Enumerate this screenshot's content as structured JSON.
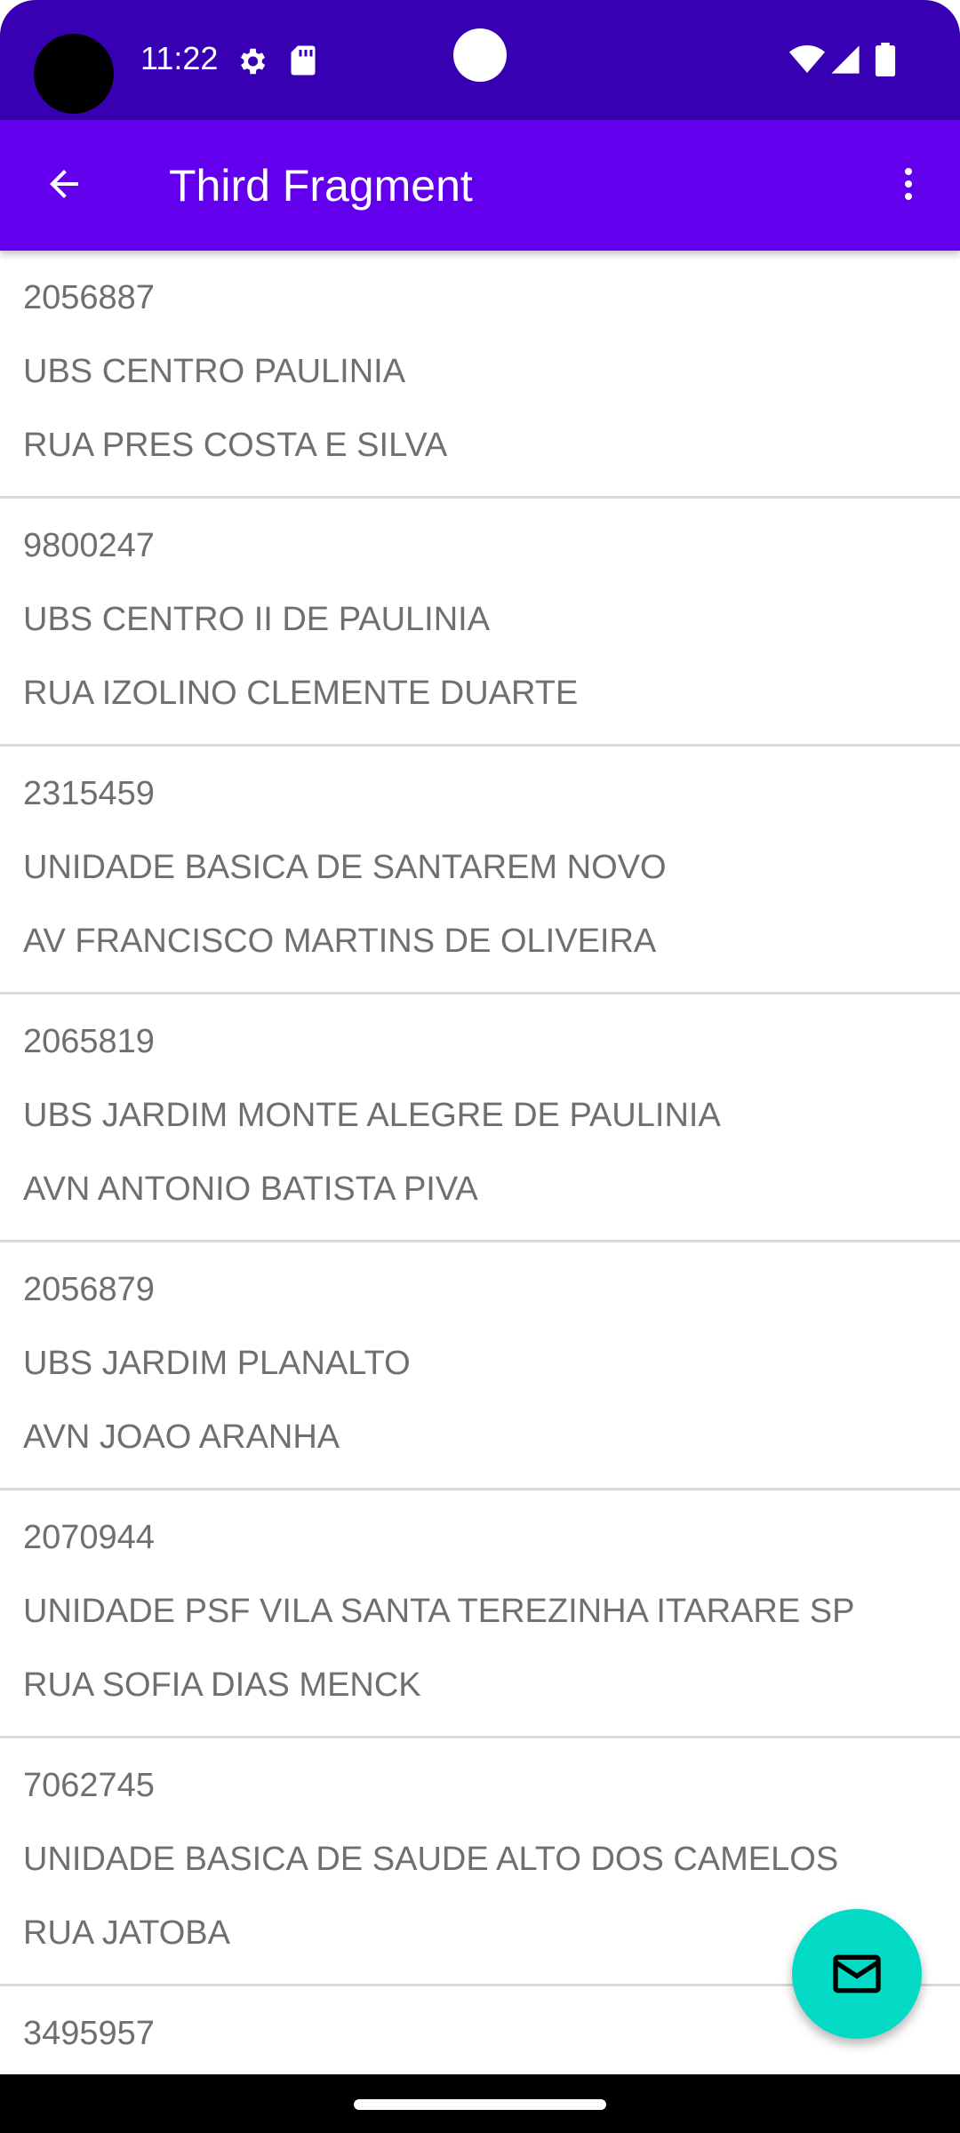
{
  "status_bar": {
    "time": "11:22",
    "icons": [
      "gear-icon",
      "sd-card-icon",
      "wifi-icon",
      "signal-icon",
      "battery-icon"
    ],
    "background": "#3700b3"
  },
  "app_bar": {
    "title": "Third Fragment",
    "back_icon": "arrow-back-icon",
    "menu_icon": "more-vert-icon",
    "background": "#6200ee"
  },
  "list": {
    "items": [
      {
        "code": "2056887",
        "name": "UBS CENTRO PAULINIA",
        "address": "RUA PRES COSTA E SILVA"
      },
      {
        "code": "9800247",
        "name": "UBS CENTRO II DE PAULINIA",
        "address": "RUA IZOLINO CLEMENTE DUARTE"
      },
      {
        "code": "2315459",
        "name": "UNIDADE BASICA DE SANTAREM NOVO",
        "address": "AV FRANCISCO MARTINS DE OLIVEIRA"
      },
      {
        "code": "2065819",
        "name": "UBS JARDIM MONTE ALEGRE DE PAULINIA",
        "address": "AVN ANTONIO BATISTA PIVA"
      },
      {
        "code": "2056879",
        "name": "UBS JARDIM PLANALTO",
        "address": "AVN JOAO ARANHA"
      },
      {
        "code": "2070944",
        "name": "UNIDADE PSF VILA SANTA TEREZINHA ITARARE SP",
        "address": "RUA SOFIA DIAS MENCK"
      },
      {
        "code": "7062745",
        "name": "UNIDADE BASICA DE SAUDE ALTO DOS CAMELOS",
        "address": "RUA JATOBA"
      },
      {
        "code": "3495957",
        "name": "",
        "address": ""
      }
    ]
  },
  "fab": {
    "icon": "email-icon",
    "color": "#03dac5"
  }
}
